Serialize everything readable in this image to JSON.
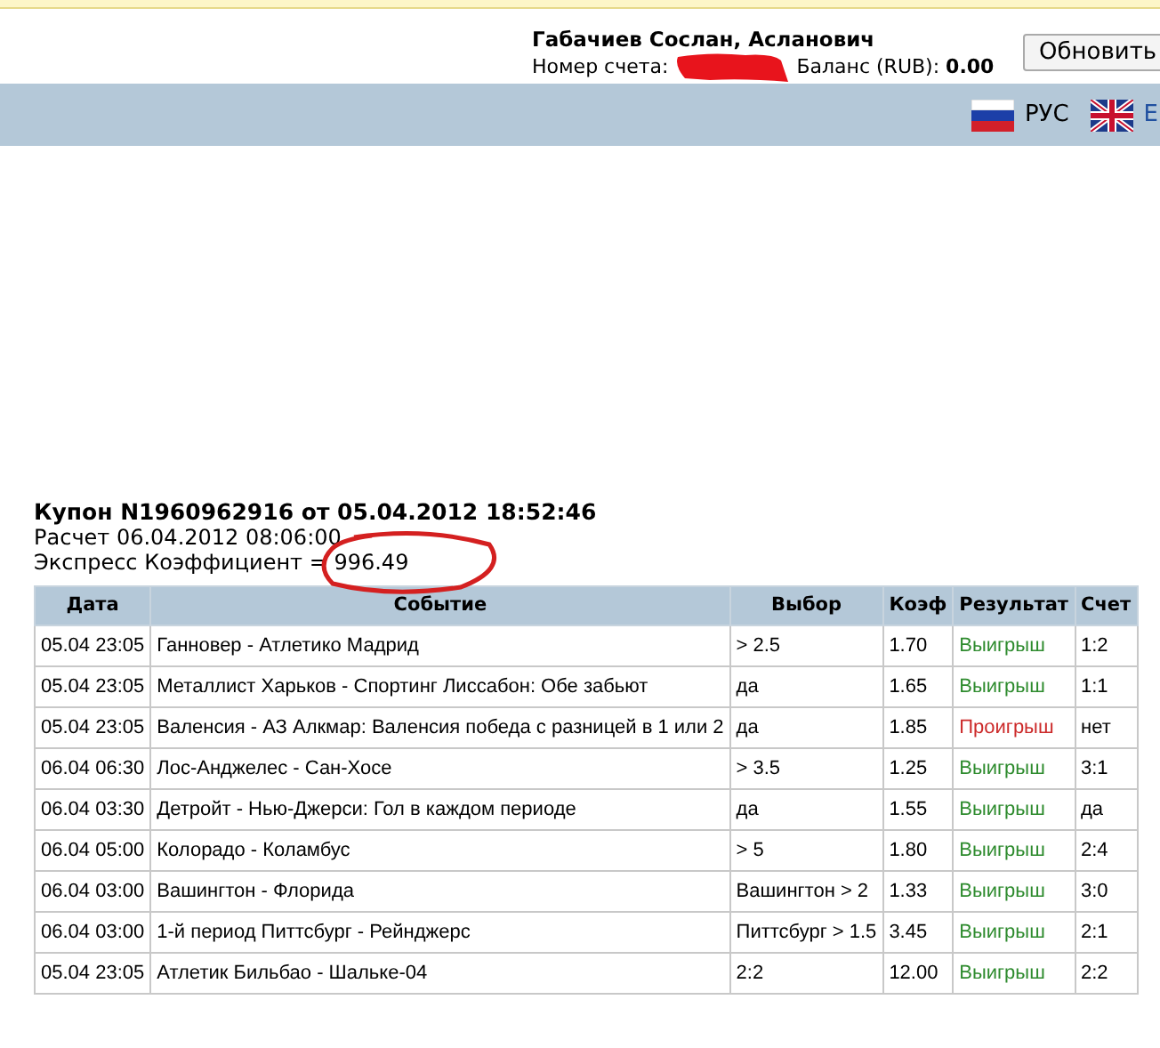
{
  "header": {
    "user_name": "Габачиев Сослан, Асланович",
    "account_label": "Номер счета:",
    "balance_label": "Баланс (RUB):",
    "balance_value": "0.00",
    "refresh_button": "Обновить"
  },
  "languages": [
    {
      "label": "РУС",
      "kind": "ru"
    },
    {
      "label": "E",
      "kind": "uk"
    }
  ],
  "coupon": {
    "title": "Купон N1960962916 от 05.04.2012 18:52:46",
    "settled": "Расчет 06.04.2012 08:06:00",
    "express": "Экспресс Коэффициент = 996.49"
  },
  "table": {
    "columns": [
      "Дата",
      "Событие",
      "Выбор",
      "Коэф",
      "Результат",
      "Счет"
    ],
    "rows": [
      {
        "date": "05.04 23:05",
        "event": "Ганновер - Атлетико Мадрид",
        "pick": "> 2.5",
        "odds": "1.70",
        "result": "Выигрыш",
        "kind": "win",
        "score": "1:2"
      },
      {
        "date": "05.04 23:05",
        "event": "Металлист Харьков - Спортинг Лиссабон: Обе забьют",
        "pick": "да",
        "odds": "1.65",
        "result": "Выигрыш",
        "kind": "win",
        "score": "1:1"
      },
      {
        "date": "05.04 23:05",
        "event": "Валенсия - АЗ Алкмар: Валенсия победа с разницей в 1 или 2",
        "pick": "да",
        "odds": "1.85",
        "result": "Проигрыш",
        "kind": "loss",
        "score": "нет"
      },
      {
        "date": "06.04 06:30",
        "event": "Лос-Анджелес - Сан-Хосе",
        "pick": "> 3.5",
        "odds": "1.25",
        "result": "Выигрыш",
        "kind": "win",
        "score": "3:1"
      },
      {
        "date": "06.04 03:30",
        "event": "Детройт - Нью-Джерси: Гол в каждом периоде",
        "pick": "да",
        "odds": "1.55",
        "result": "Выигрыш",
        "kind": "win",
        "score": "да"
      },
      {
        "date": "06.04 05:00",
        "event": "Колорадо - Коламбус",
        "pick": "> 5",
        "odds": "1.80",
        "result": "Выигрыш",
        "kind": "win",
        "score": "2:4"
      },
      {
        "date": "06.04 03:00",
        "event": "Вашингтон - Флорида",
        "pick": "Вашингтон > 2",
        "odds": "1.33",
        "result": "Выигрыш",
        "kind": "win",
        "score": "3:0"
      },
      {
        "date": "06.04 03:00",
        "event": "1-й период Питтсбург - Рейнджерс",
        "pick": "Питтсбург > 1.5",
        "odds": "3.45",
        "result": "Выигрыш",
        "kind": "win",
        "score": "2:1"
      },
      {
        "date": "05.04 23:05",
        "event": "Атлетик Бильбао - Шальке-04",
        "pick": "2:2",
        "odds": "12.00",
        "result": "Выигрыш",
        "kind": "win",
        "score": "2:2"
      }
    ]
  }
}
